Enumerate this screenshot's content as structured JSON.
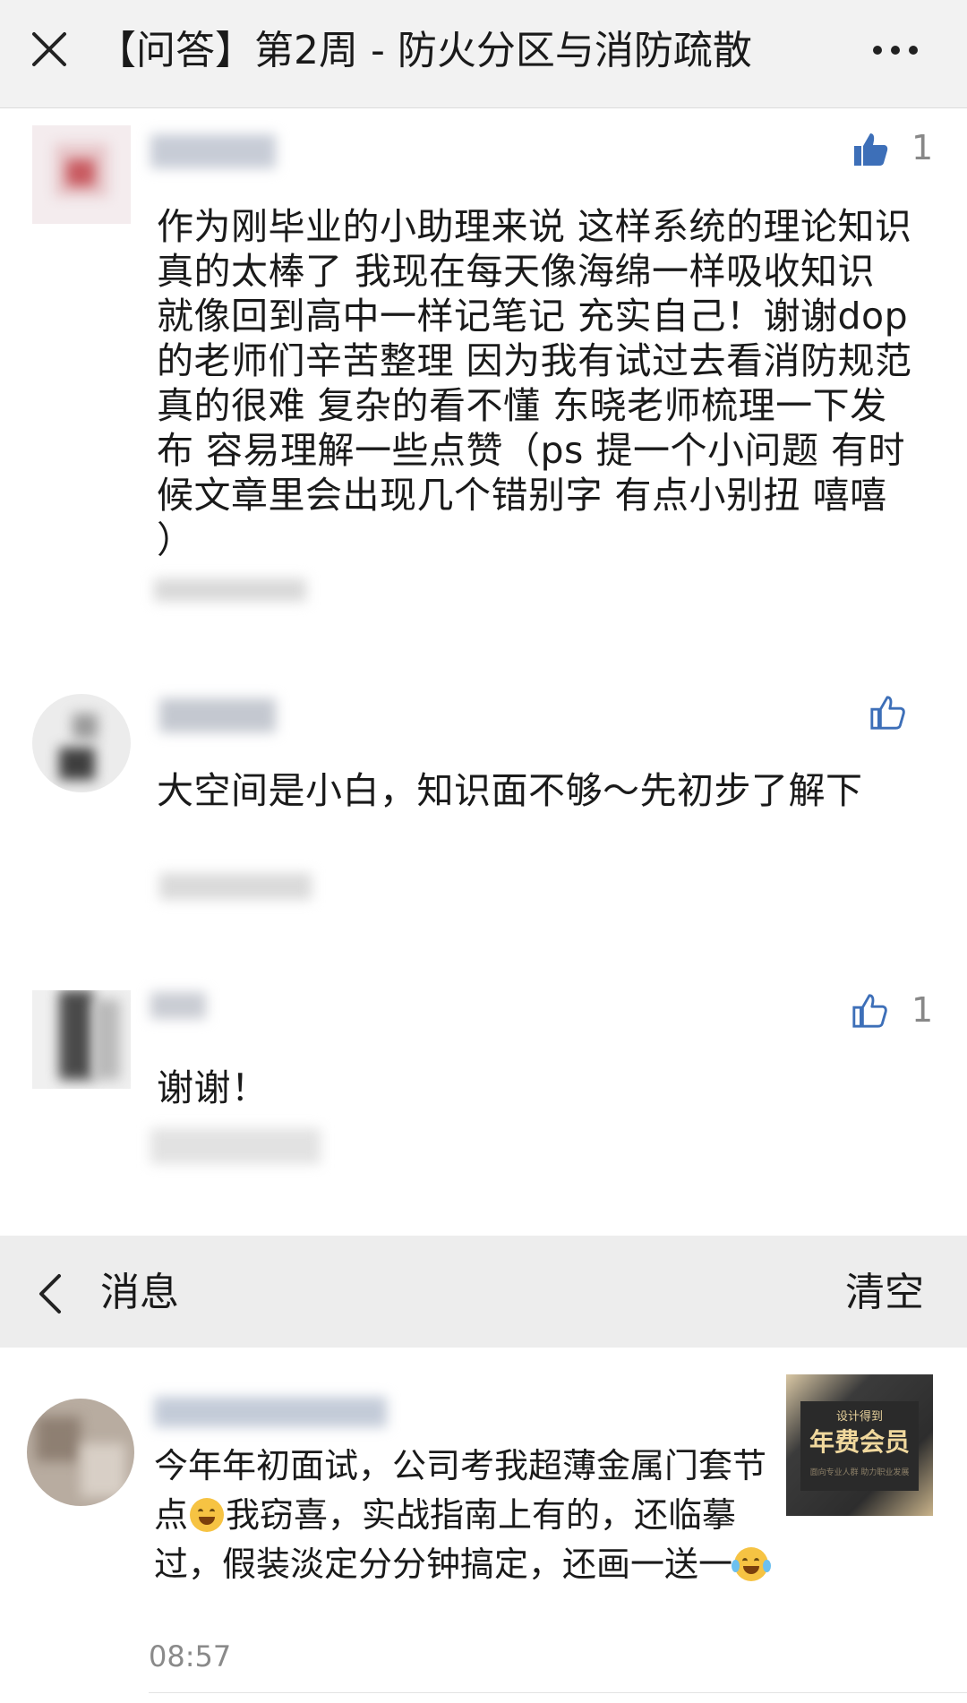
{
  "header": {
    "title": "【问答】第2周 - 防火分区与消防疏散",
    "close_icon": "close-icon",
    "more_icon": "more-dots-icon"
  },
  "comments": [
    {
      "likes": "1",
      "like_icon": "thumbs-up-filled-icon",
      "text": "作为刚毕业的小助理来说 这样系统的理论知识真的太棒了 我现在每天像海绵一样吸收知识 就像回到高中一样记笔记 充实自己！谢谢dop的老师们辛苦整理 因为我有试过去看消防规范 真的很难 复杂的看不懂 东晓老师梳理一下发布 容易理解一些点赞（ps 提一个小问题 有时候文章里会出现几个错别字 有点小别扭 嘻嘻 ）"
    },
    {
      "likes": "",
      "like_icon": "thumbs-up-outline-icon",
      "text": "大空间是小白，知识面不够～先初步了解下"
    },
    {
      "likes": "1",
      "like_icon": "thumbs-up-outline-icon",
      "text": "谢谢！"
    }
  ],
  "messages_panel": {
    "back_icon": "chevron-left-icon",
    "title": "消息",
    "clear_label": "清空"
  },
  "message": {
    "text_part1": "今年年初面试，公司考我超薄金属门套节点",
    "emoji1": "grinning-emoji",
    "text_part2": "我窃喜，实战指南上有的，还临摹过，假装淡定分分钟搞定，还画一送一",
    "emoji2": "tears-of-joy-emoji",
    "time": "08:57",
    "thumbnail": {
      "line1": "设计得到",
      "line2": "年费会员",
      "line3": "面向专业人群  助力职业发展"
    }
  }
}
